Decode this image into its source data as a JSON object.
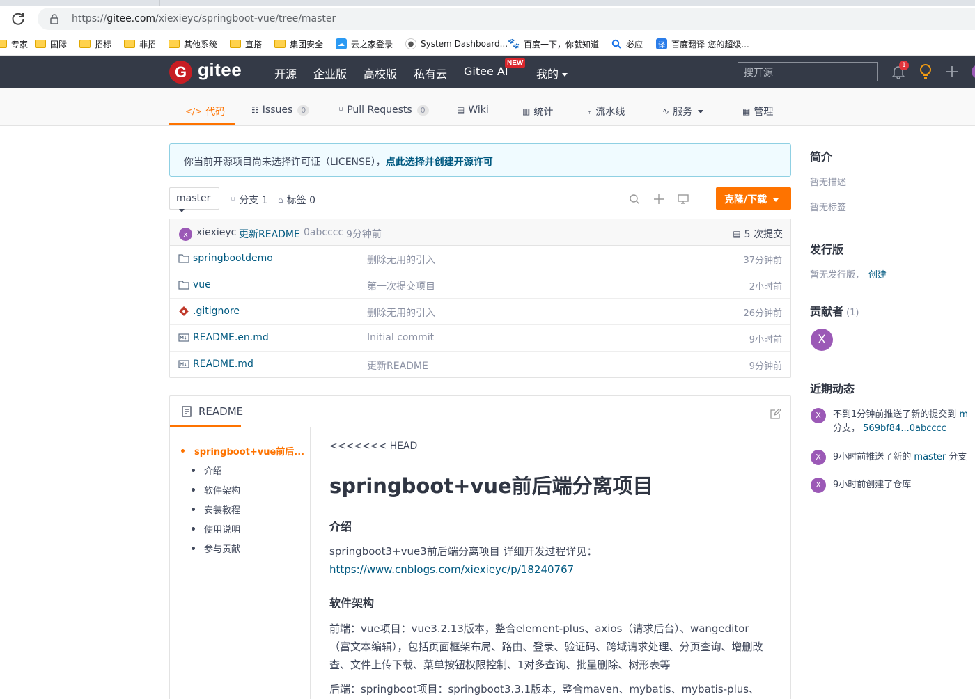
{
  "browser": {
    "url_prefix": "https://",
    "url_host": "gitee.com",
    "url_path": "/xiexieyc/springboot-vue/tree/master"
  },
  "bookmarks": [
    {
      "label": "专家",
      "type": "folder"
    },
    {
      "label": "国际",
      "type": "folder"
    },
    {
      "label": "招标",
      "type": "folder"
    },
    {
      "label": "非招",
      "type": "folder"
    },
    {
      "label": "其他系统",
      "type": "folder"
    },
    {
      "label": "直搭",
      "type": "folder"
    },
    {
      "label": "集团安全",
      "type": "folder"
    },
    {
      "label": "云之家登录",
      "type": "site",
      "icon": "cloud-icon",
      "color": "#2b9af3"
    },
    {
      "label": "System Dashboard...",
      "type": "site",
      "icon": "jira-icon",
      "color": "#555"
    },
    {
      "label": "百度一下，你就知道",
      "type": "site",
      "icon": "baidu-paw-icon",
      "color": "#2932e1"
    },
    {
      "label": "必应",
      "type": "site",
      "icon": "search-icon",
      "color": "#1a73e8"
    },
    {
      "label": "百度翻译-您的超级...",
      "type": "site",
      "icon": "translate-icon",
      "color": "#2b7de9"
    }
  ],
  "header": {
    "logo_letter": "G",
    "logo_text": "gitee",
    "nav": [
      "开源",
      "企业版",
      "高校版",
      "私有云",
      "Gitee AI",
      "我的"
    ],
    "new_badge": "NEW",
    "search_placeholder": "搜开源",
    "notification_count": "1",
    "brand_color": "#c71d23"
  },
  "repo_tabs": [
    {
      "label": "代码",
      "icon": "code-icon",
      "active": true
    },
    {
      "label": "Issues",
      "icon": "issues-icon",
      "count": "0"
    },
    {
      "label": "Pull Requests",
      "icon": "pull-request-icon",
      "count": "0"
    },
    {
      "label": "Wiki",
      "icon": "wiki-icon"
    },
    {
      "label": "统计",
      "icon": "stats-icon"
    },
    {
      "label": "流水线",
      "icon": "pipeline-icon"
    },
    {
      "label": "服务",
      "icon": "service-icon",
      "dropdown": true
    },
    {
      "label": "管理",
      "icon": "manage-icon"
    }
  ],
  "notice": {
    "text": "你当前开源项目尚未选择许可证（LICENSE），",
    "link": "点此选择并创建开源许可"
  },
  "branch_bar": {
    "branch": "master",
    "branches_label": "分支 1",
    "tags_label": "标签 0",
    "clone_label": "克隆/下载"
  },
  "last_commit": {
    "avatar_letter": "x",
    "author": "xiexieyc",
    "message": "更新README",
    "hash": "0abcccc",
    "time": "9分钟前",
    "commits_label": "5 次提交"
  },
  "files": [
    {
      "name": "springbootdemo",
      "icon": "folder-icon",
      "message": "删除无用的引入",
      "time": "37分钟前"
    },
    {
      "name": "vue",
      "icon": "folder-icon",
      "message": "第一次提交项目",
      "time": "2小时前"
    },
    {
      "name": ".gitignore",
      "icon": "git-icon",
      "message": "删除无用的引入",
      "time": "26分钟前"
    },
    {
      "name": "README.en.md",
      "icon": "markdown-icon",
      "message": "Initial commit",
      "time": "9小时前"
    },
    {
      "name": "README.md",
      "icon": "markdown-icon",
      "message": "更新README",
      "time": "9分钟前"
    }
  ],
  "readme": {
    "tab_label": "README",
    "toc": [
      "springboot+vue前后...",
      "介绍",
      "软件架构",
      "安装教程",
      "使用说明",
      "参与贡献"
    ],
    "head_marker": "<<<<<<< HEAD",
    "h1": "springboot+vue前后端分离项目",
    "intro_heading": "介绍",
    "intro_text": "springboot3+vue3前后端分离项目 详细开发过程详见：",
    "intro_link": "https://www.cnblogs.com/xiexieyc/p/18240767",
    "arch_heading": "软件架构",
    "arch_frontend": "前端：vue项目：vue3.2.13版本，整合element-plus、axios（请求后台）、wangeditor（富文本编辑），包括页面框架布局、路由、登录、验证码、跨域请求处理、分页查询、增删改查、文件上传下载、菜单按钮权限控制、1对多查询、批量删除、树形表等",
    "arch_backend": "后端：springboot项目：springboot3.3.1版本，整合maven、mybatis、mybatis-plus、"
  },
  "sidebar": {
    "intro_heading": "简介",
    "no_desc": "暂无描述",
    "no_tags": "暂无标签",
    "release_heading": "发行版",
    "no_release": "暂无发行版，",
    "create_link": "创建",
    "contrib_heading": "贡献者",
    "contrib_count": "(1)",
    "contrib_avatar": "X",
    "activity_heading": "近期动态",
    "activities": [
      {
        "avatar": "X",
        "text": "不到1分钟前推送了新的提交到",
        "link": "m",
        "line2_pre": "分支，",
        "line2_link": "569bf84...0abcccc"
      },
      {
        "avatar": "X",
        "pre": "9小时前推送了新的",
        "link": "master",
        "post": "分支"
      },
      {
        "avatar": "X",
        "text": "9小时前创建了仓库"
      }
    ]
  }
}
